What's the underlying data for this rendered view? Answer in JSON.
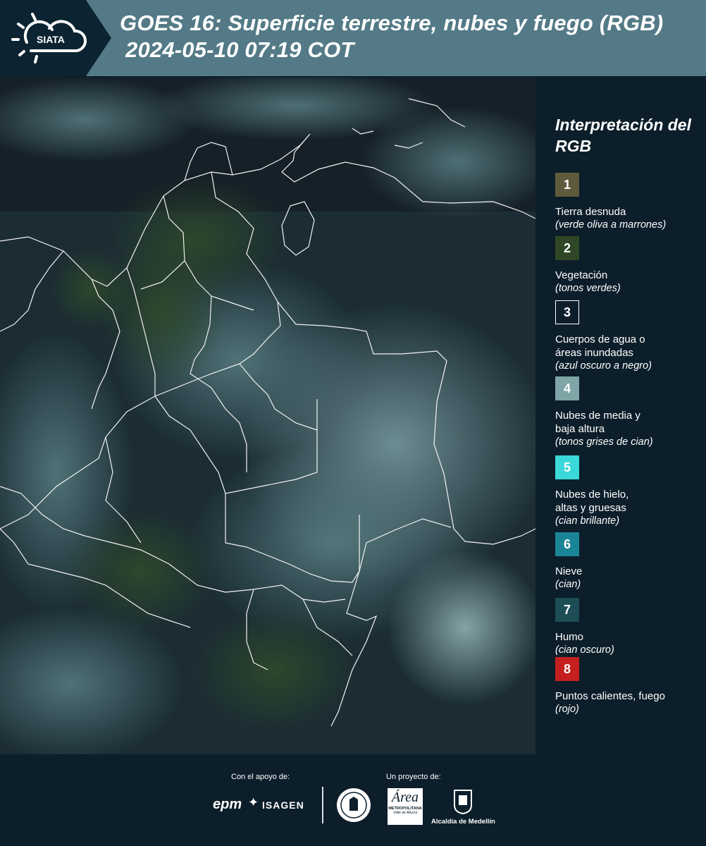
{
  "header": {
    "logo_text": "SIATA",
    "title_line1": "GOES 16: Superficie terrestre, nubes y fuego (RGB)",
    "title_line2": "2024-05-10 07:19 COT"
  },
  "legend": {
    "title": "Interpretación del RGB",
    "items": [
      {
        "number": "1",
        "color": "#5e5b3d",
        "label": "Tierra desnuda",
        "desc": "(verde oliva a marrones)"
      },
      {
        "number": "2",
        "color": "#2f4726",
        "label": "Vegetación",
        "desc": "(tonos verdes)"
      },
      {
        "number": "3",
        "color": "#0c1e2a",
        "label": "Cuerpos de agua o\náreas inundadas",
        "desc": "(azul oscuro a negro)"
      },
      {
        "number": "4",
        "color": "#7fa5a6",
        "label": "Nubes de media y\nbaja altura",
        "desc": "(tonos grises de cian)"
      },
      {
        "number": "5",
        "color": "#3ad8d8",
        "label": "Nubes de hielo,\naltas y gruesas",
        "desc": "(cian brillante)"
      },
      {
        "number": "6",
        "color": "#1b8598",
        "label": "Nieve",
        "desc": "(cian)"
      },
      {
        "number": "7",
        "color": "#1d4d55",
        "label": "Humo",
        "desc": "(cian oscuro)"
      },
      {
        "number": "8",
        "color": "#c4201f",
        "label": "Puntos calientes, fuego",
        "desc": "(rojo)"
      }
    ]
  },
  "footer": {
    "support_label": "Con el apoyo de:",
    "project_label": "Un proyecto de:",
    "sponsor_epm": "epm",
    "sponsor_isagen": "ISAGEN",
    "area_logo_text": "Área",
    "area_sub": "METROPOLITANA",
    "area_sub2": "Valle de Aburrá",
    "alcaldia": "Alcaldía de Medellín"
  }
}
